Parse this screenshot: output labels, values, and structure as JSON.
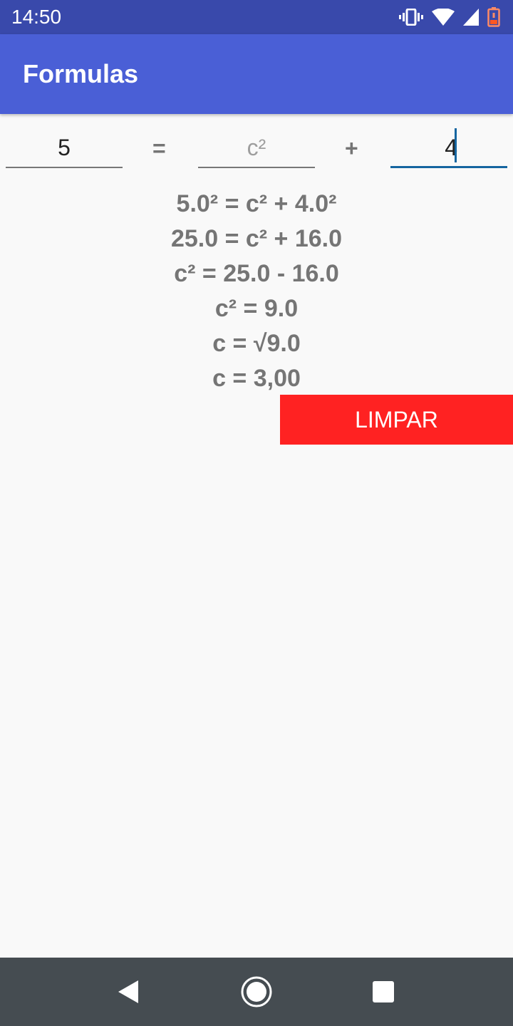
{
  "status_bar": {
    "time": "14:50",
    "icons": [
      "vibrate-icon",
      "wifi-icon",
      "cell-signal-icon",
      "battery-low-icon"
    ],
    "background": "#3949ab"
  },
  "app_bar": {
    "title": "Formulas",
    "background": "#4a5fd6"
  },
  "equation": {
    "field_a_value": "5",
    "equals_symbol": "=",
    "field_c_placeholder": "c²",
    "plus_symbol": "+",
    "field_b_value": "4"
  },
  "steps": [
    "5.0² = c² + 4.0²",
    "25.0 = c² + 16.0",
    "c² = 25.0 - 16.0",
    "c² = 9.0",
    "c = √9.0",
    "c = 3,00"
  ],
  "clear_button": {
    "label": "LIMPAR",
    "color": "#ff2222"
  },
  "nav_bar": {
    "buttons": [
      "back-icon",
      "home-icon",
      "recents-icon"
    ],
    "background": "#454c51"
  }
}
